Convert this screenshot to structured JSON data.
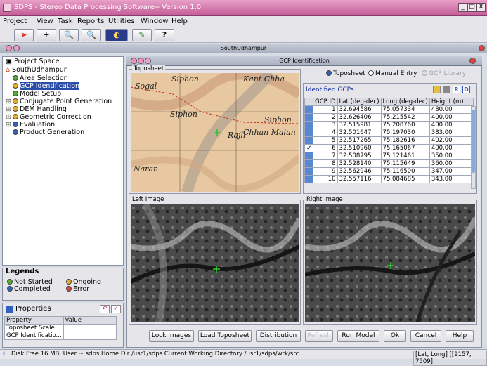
{
  "window": {
    "title": "SDPS - Stereo Data Processing Software-- Version 1.0",
    "min": "_",
    "max": "□",
    "close": "X"
  },
  "menu": [
    "Project",
    "View",
    "Task",
    "Reports",
    "Utilities",
    "Window",
    "Help"
  ],
  "toolbar": {
    "icons": [
      "arrow-icon",
      "plus-icon",
      "zoom-in-icon",
      "zoom-out-icon",
      "contrast-icon",
      "pencil-icon",
      "help-icon"
    ],
    "plus": "+",
    "help": "?"
  },
  "frame": {
    "title": "SouthUdhampur"
  },
  "project": {
    "header": "Project Space",
    "root": "SouthUdhampur",
    "items": [
      {
        "label": "Area Selection",
        "color": "#4caf2e",
        "exp": ""
      },
      {
        "label": "GCP Identification",
        "color": "#e8b020",
        "exp": "",
        "selected": true
      },
      {
        "label": "Model Setup",
        "color": "#4caf2e",
        "exp": ""
      },
      {
        "label": "Conjugate Point Generation",
        "color": "#e8b020",
        "exp": "⊞"
      },
      {
        "label": "DEM Handling",
        "color": "#e8b020",
        "exp": "⊞"
      },
      {
        "label": "Geometric Correction",
        "color": "#e8b020",
        "exp": "⊞"
      },
      {
        "label": "Evaluation",
        "color": "#3060c0",
        "exp": "⊞"
      },
      {
        "label": "Product Generation",
        "color": "#3060c0",
        "exp": ""
      }
    ]
  },
  "legends": {
    "title": "Legends",
    "not_started": "Not Started",
    "ongoing": "Ongoing",
    "completed": "Completed",
    "error": "Error"
  },
  "properties": {
    "title": "Properties",
    "col_property": "Property",
    "col_value": "Value",
    "rows": [
      "Toposheet Scale",
      "GCP Identificatio..."
    ]
  },
  "gcp_window": {
    "title": "GCP Identification",
    "toposheet_label": "Toposheet",
    "left_label": "Left Image",
    "right_label": "Right Image",
    "radio": {
      "toposheet": "Toposheet",
      "manual": "Manual Entry",
      "library": "GCP Library"
    },
    "identified": "Identified GCPs",
    "tool_r": "R",
    "tool_d": "D",
    "columns": [
      "GCP ID",
      "Lat (deg-dec)",
      "Long (deg-dec)",
      "Height (m)"
    ],
    "rows": [
      [
        "1",
        "32.694586",
        "75.057334",
        "480.00"
      ],
      [
        "2",
        "32.626406",
        "75.215542",
        "400.00"
      ],
      [
        "3",
        "32.515981",
        "75.208760",
        "400.00"
      ],
      [
        "4",
        "32.501647",
        "75.197030",
        "383.00"
      ],
      [
        "5",
        "32.517265",
        "75.182616",
        "402.00"
      ],
      [
        "6",
        "32.510960",
        "75.165067",
        "400.00"
      ],
      [
        "7",
        "32.508795",
        "75.121461",
        "350.00"
      ],
      [
        "8",
        "32.528140",
        "75.115649",
        "360.00"
      ],
      [
        "9",
        "32.562946",
        "75.116500",
        "347.00"
      ],
      [
        "10",
        "32.557116",
        "75.084685",
        "343.00"
      ]
    ],
    "checked_row": 6,
    "map_text": [
      "Sogal",
      "Siphon",
      "Kant Chha",
      "Siphon",
      "Chhan Malan",
      "Rajli",
      "Siphon",
      "Naran"
    ],
    "buttons": [
      "Lock Images",
      "Load Toposheet",
      "Distribution",
      "Refresh",
      "Run Model",
      "Ok",
      "Cancel",
      "Help"
    ]
  },
  "status": {
    "text": "Disk Free 16 MB. User ~ sdps Home Dir /usr1/sdps Current Working Directory /usr1/sdps/wrk/src",
    "coord": "[Lat, Long] [[9157, 7509]"
  }
}
